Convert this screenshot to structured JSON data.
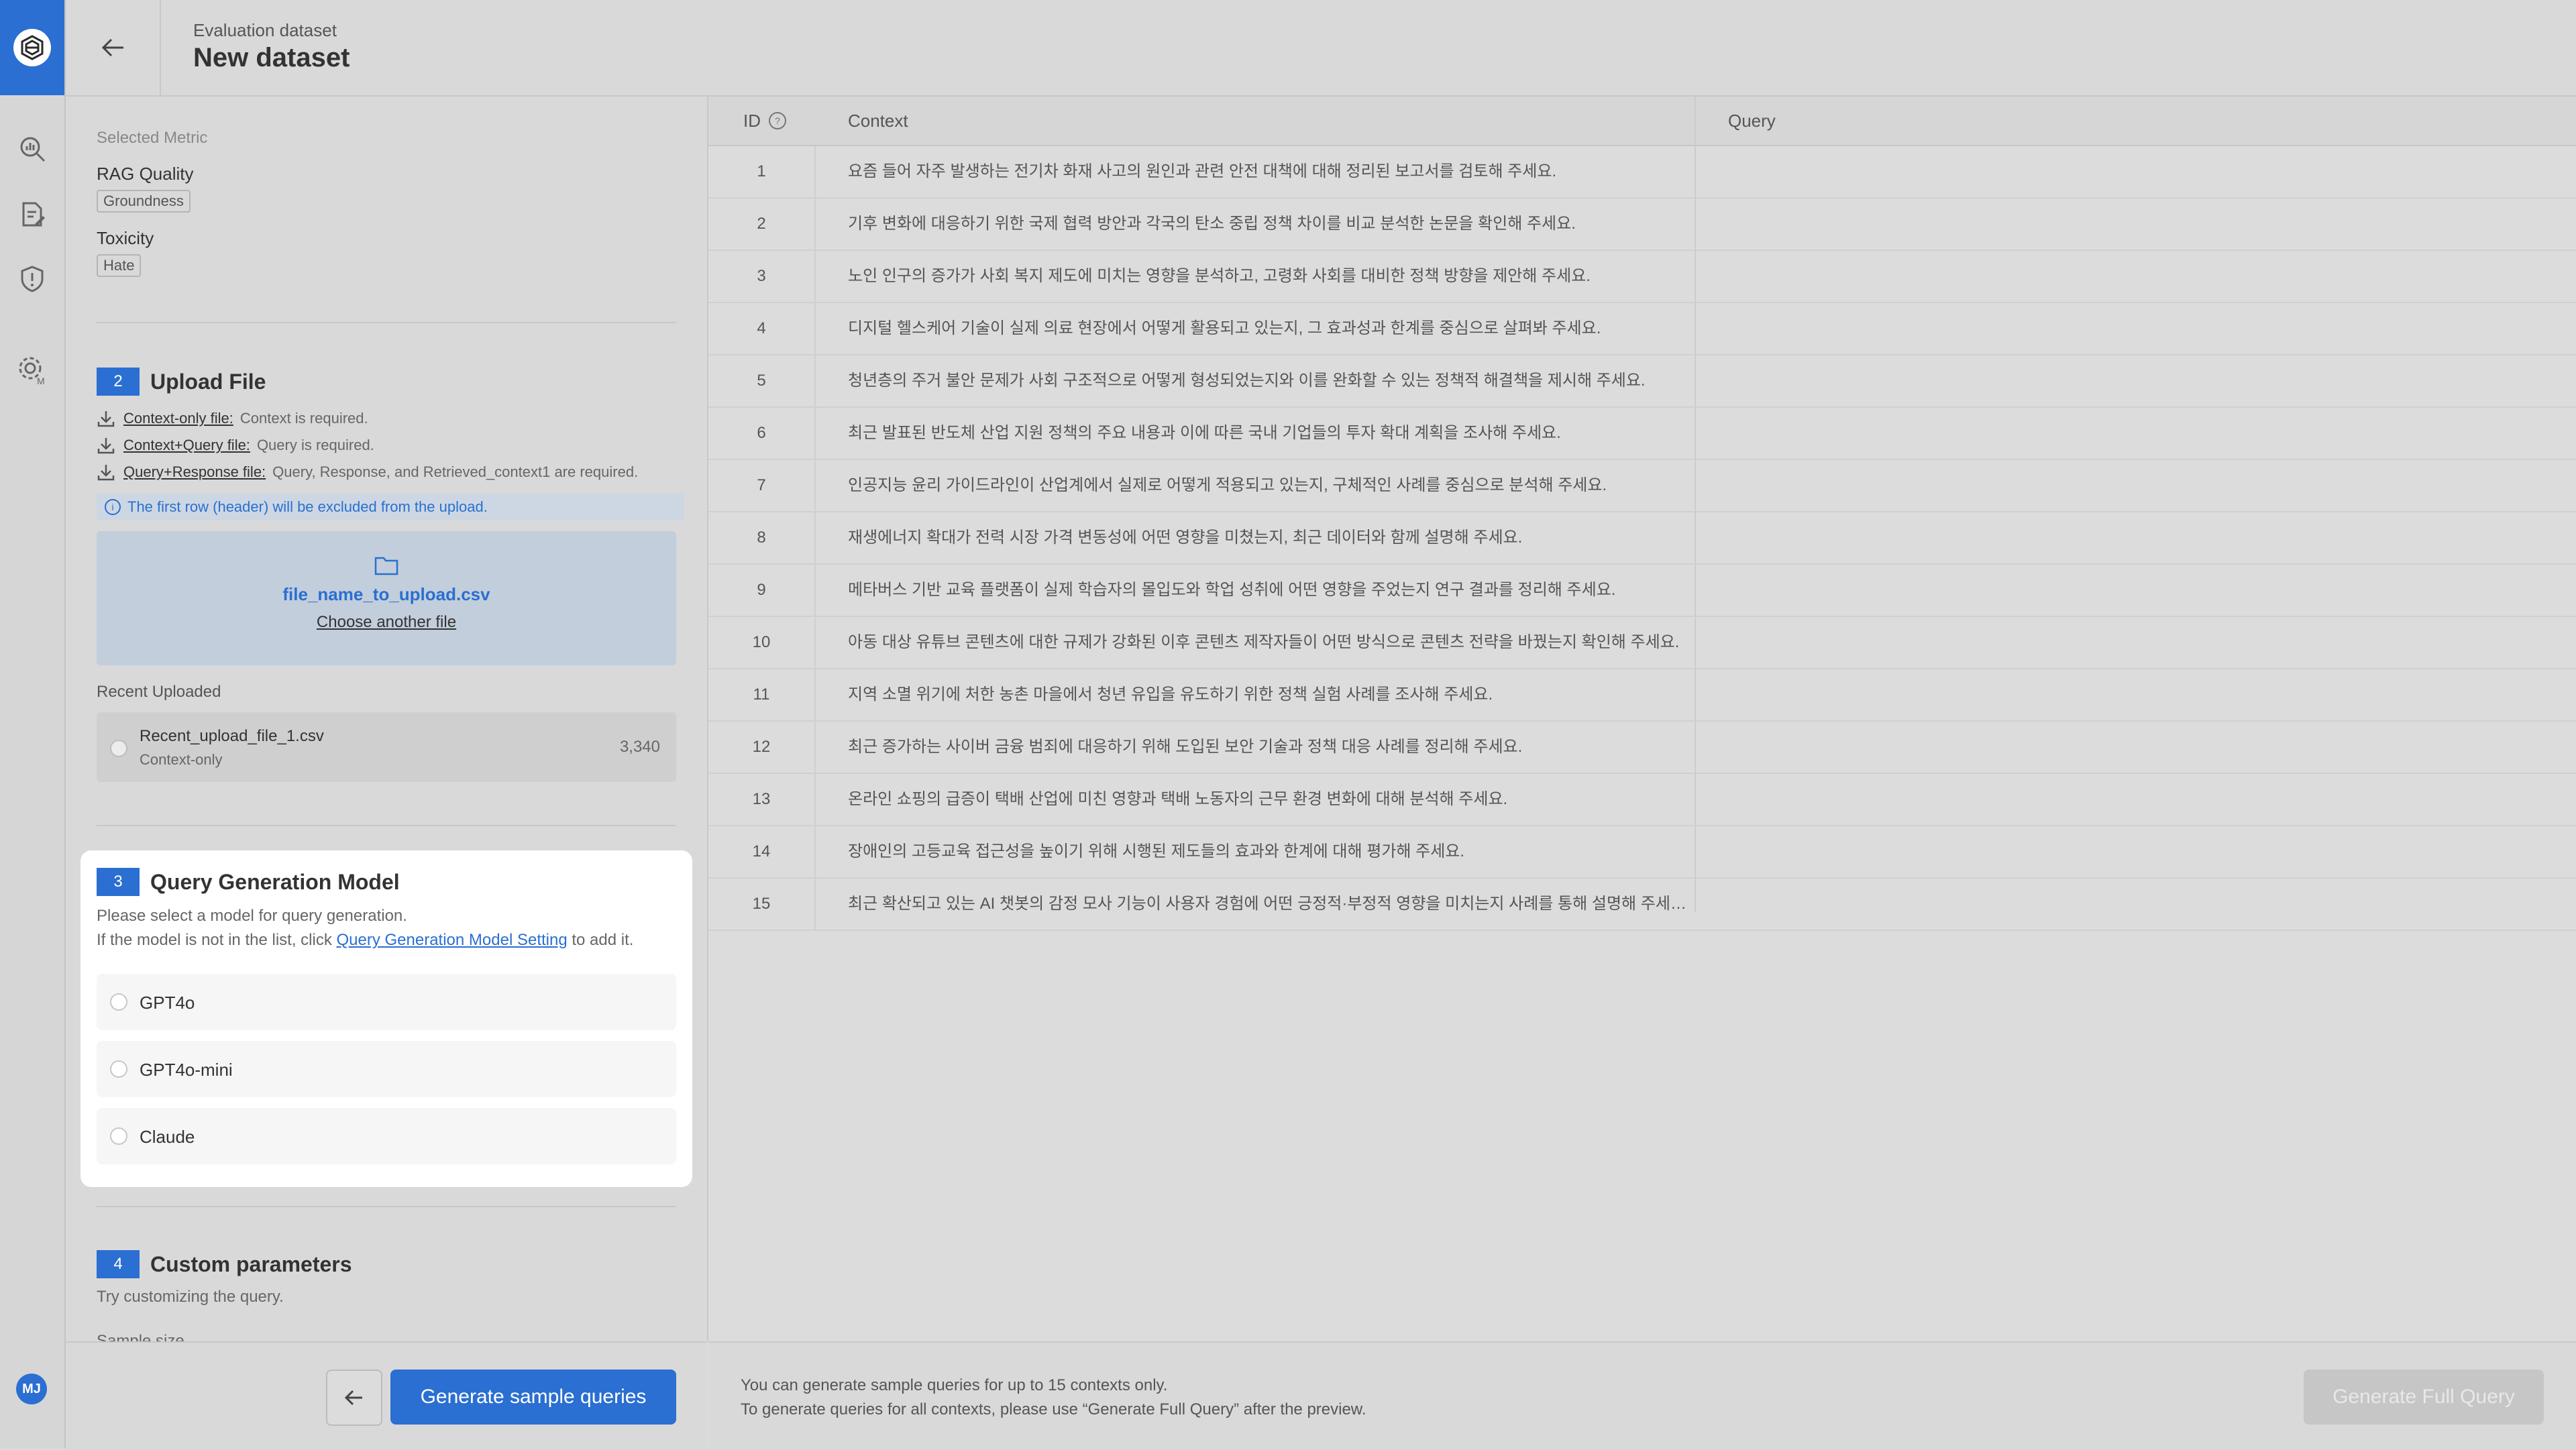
{
  "header": {
    "breadcrumb": "Evaluation dataset",
    "title": "New dataset"
  },
  "user": {
    "initials": "MJ"
  },
  "selected_metric": {
    "label": "Selected Metric",
    "groups": [
      {
        "name": "RAG Quality",
        "tag": "Groundness"
      },
      {
        "name": "Toxicity",
        "tag": "Hate"
      }
    ]
  },
  "upload": {
    "step": "2",
    "title": "Upload File",
    "file_types": [
      {
        "link": "Context-only file:",
        "desc": "Context is required."
      },
      {
        "link": "Context+Query file:",
        "desc": "Query is required."
      },
      {
        "link": "Query+Response file:",
        "desc": "Query, Response, and Retrieved_context1 are required."
      }
    ],
    "info": "The first row (header) will be excluded from the upload.",
    "file_name": "file_name_to_upload.csv",
    "choose_label": "Choose another file",
    "recent_label": "Recent Uploaded",
    "recent_file": {
      "name": "Recent_upload_file_1.csv",
      "type": "Context-only",
      "count": "3,340"
    }
  },
  "query_model": {
    "step": "3",
    "title": "Query Generation Model",
    "desc1": "Please select a model for query generation.",
    "desc2_prefix": "If the model is not in the list, click",
    "desc2_link": "Query Generation Model Setting",
    "desc2_suffix": "to add it.",
    "options": [
      "GPT4o",
      "GPT4o-mini",
      "Claude"
    ]
  },
  "custom": {
    "step": "4",
    "title": "Custom parameters",
    "desc": "Try customizing the query.",
    "next_label": "Sample size"
  },
  "buttons": {
    "generate_sample": "Generate sample queries",
    "generate_full": "Generate Full Query"
  },
  "footer": {
    "note1": "You can generate sample queries for up to 15 contexts only.",
    "note2": "To generate queries for all contexts, please use “Generate Full Query” after the preview."
  },
  "table": {
    "headers": {
      "id": "ID",
      "context": "Context",
      "query": "Query"
    },
    "rows": [
      {
        "id": "1",
        "context": "요즘 들어 자주 발생하는 전기차 화재 사고의 원인과 관련 안전 대책에 대해 정리된 보고서를 검토해 주세요."
      },
      {
        "id": "2",
        "context": "기후 변화에 대응하기 위한 국제 협력 방안과 각국의 탄소 중립 정책 차이를 비교 분석한 논문을 확인해 주세요."
      },
      {
        "id": "3",
        "context": "노인 인구의 증가가 사회 복지 제도에 미치는 영향을 분석하고, 고령화 사회를 대비한 정책 방향을 제안해 주세요."
      },
      {
        "id": "4",
        "context": "디지털 헬스케어 기술이 실제 의료 현장에서 어떻게 활용되고 있는지, 그 효과성과 한계를 중심으로 살펴봐 주세요."
      },
      {
        "id": "5",
        "context": "청년층의 주거 불안 문제가 사회 구조적으로 어떻게 형성되었는지와 이를 완화할 수 있는 정책적 해결책을 제시해 주세요."
      },
      {
        "id": "6",
        "context": "최근 발표된 반도체 산업 지원 정책의 주요 내용과 이에 따른 국내 기업들의 투자 확대 계획을 조사해 주세요."
      },
      {
        "id": "7",
        "context": "인공지능 윤리 가이드라인이 산업계에서 실제로 어떻게 적용되고 있는지, 구체적인 사례를 중심으로 분석해 주세요."
      },
      {
        "id": "8",
        "context": "재생에너지 확대가 전력 시장 가격 변동성에 어떤 영향을 미쳤는지, 최근 데이터와 함께 설명해 주세요."
      },
      {
        "id": "9",
        "context": "메타버스 기반 교육 플랫폼이 실제 학습자의 몰입도와 학업 성취에 어떤 영향을 주었는지 연구 결과를 정리해 주세요."
      },
      {
        "id": "10",
        "context": "아동 대상 유튜브 콘텐츠에 대한 규제가 강화된 이후 콘텐츠 제작자들이 어떤 방식으로 콘텐츠 전략을 바꿨는지 확인해 주세요."
      },
      {
        "id": "11",
        "context": "지역 소멸 위기에 처한 농촌 마을에서 청년 유입을 유도하기 위한 정책 실험 사례를 조사해 주세요."
      },
      {
        "id": "12",
        "context": "최근 증가하는 사이버 금융 범죄에 대응하기 위해 도입된 보안 기술과 정책 대응 사례를 정리해 주세요."
      },
      {
        "id": "13",
        "context": "온라인 쇼핑의 급증이 택배 산업에 미친 영향과 택배 노동자의 근무 환경 변화에 대해 분석해 주세요."
      },
      {
        "id": "14",
        "context": "장애인의 고등교육 접근성을 높이기 위해 시행된 제도들의 효과와 한계에 대해 평가해 주세요."
      },
      {
        "id": "15",
        "context": "최근 확산되고 있는 AI 챗봇의 감정 모사 기능이 사용자 경험에 어떤 긍정적·부정적 영향을 미치는지 사례를 통해 설명해 주세…"
      }
    ]
  }
}
